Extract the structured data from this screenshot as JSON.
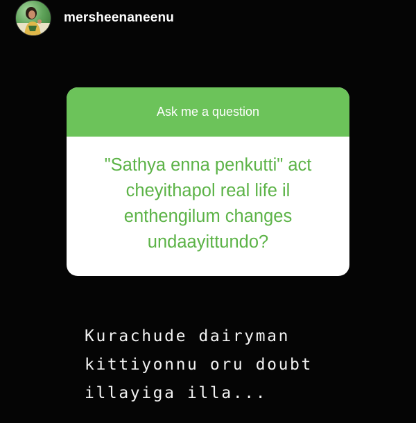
{
  "story": {
    "username": "mersheenaneenu",
    "avatar_icon": "profile-avatar"
  },
  "question_sticker": {
    "header": "Ask me a question",
    "question": "\"Sathya enna penkutti\" act cheyithapol real life il enthengilum changes undaayittundo?",
    "colors": {
      "header_bg": "#6cc35a",
      "question_text": "#5cb347"
    }
  },
  "answer": {
    "lines": [
      "Kurachude dairyman",
      "kittiyonnu oru doubt",
      "illayiga illa..."
    ]
  }
}
